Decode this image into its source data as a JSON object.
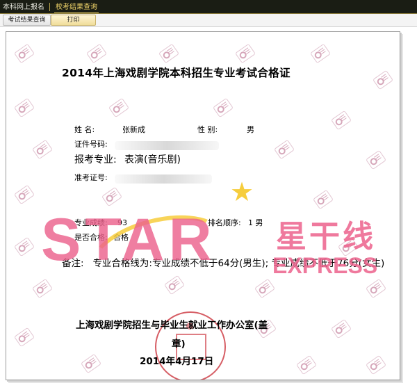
{
  "nav": {
    "tabs": [
      {
        "label": "本科网上报名"
      },
      {
        "label": "校考结果查询"
      }
    ],
    "subtabs": [
      {
        "label": "考试结果查询"
      },
      {
        "label": "打印"
      }
    ]
  },
  "certificate": {
    "title": "2014年上海戏剧学院本科招生专业考试合格证",
    "name_label": "姓    名:",
    "name_value": "张新成",
    "gender_label": "性    别:",
    "gender_value": "男",
    "id_label": "证件号码:",
    "major_label": "报考专业:",
    "major_value": "表演(音乐剧)",
    "exam_no_label": "准考证号:",
    "score_label": "专业成绩:",
    "score_value": "93",
    "rank_label": "排名顺序:",
    "rank_value": "1 男",
    "pass_label": "是否合格:",
    "pass_value": "合格",
    "note_label": "备注:",
    "note_text": "专业合格线为:专业成绩不低于64分(男生); 专业成绩不低于76分(女生)",
    "office": "上海戏剧学院招生与毕业生就业工作办公室(盖",
    "office_cont": "章)",
    "date": "2014年4月17日"
  },
  "overlay": {
    "brand_latin": "STAR",
    "brand_cn": "星干线",
    "brand_en": "EXPRESS",
    "accent_color": "#ec628c",
    "star_color": "#f5c828"
  }
}
